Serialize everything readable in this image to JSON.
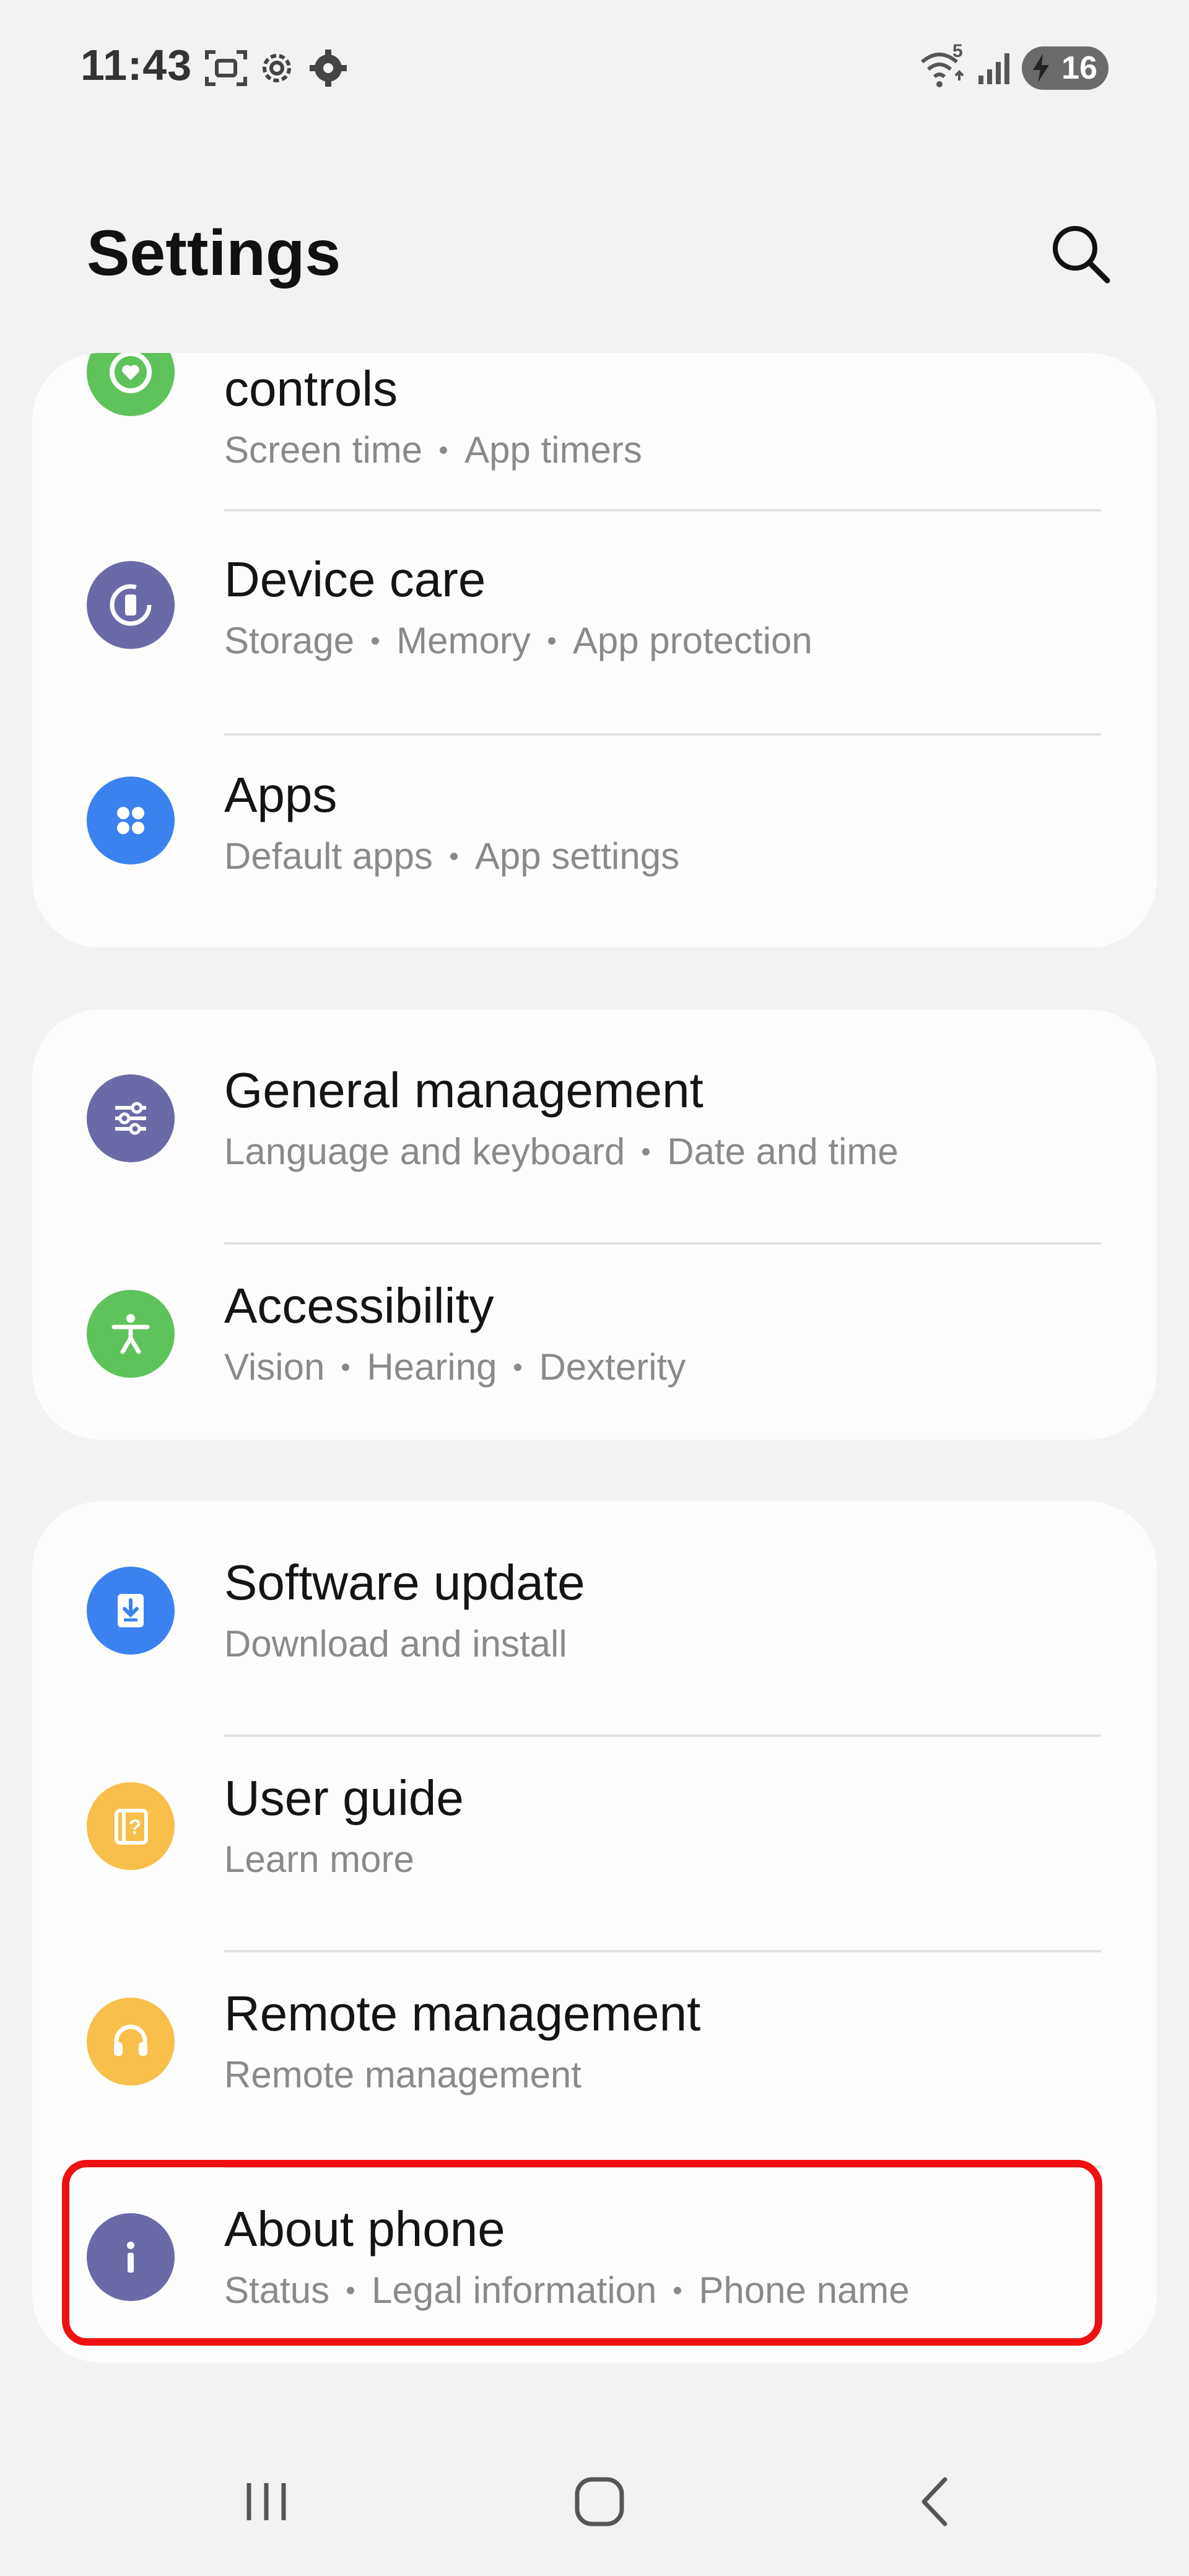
{
  "status_bar": {
    "time": "11:43",
    "wifi_badge": "5",
    "battery_level": "16",
    "icons": [
      "screenshot-icon",
      "settings-gear-outline-icon",
      "settings-gear-icon",
      "wifi-icon",
      "signal-icon",
      "battery-charging-icon"
    ]
  },
  "header": {
    "title": "Settings"
  },
  "sections": [
    {
      "items": [
        {
          "label": "controls",
          "subtitle": [
            "Screen time",
            "App timers"
          ],
          "icon": "digital-wellbeing-icon",
          "color": "#5ec35a"
        },
        {
          "label": "Device care",
          "subtitle": [
            "Storage",
            "Memory",
            "App protection"
          ],
          "icon": "device-care-icon",
          "color": "#6a6aa8"
        },
        {
          "label": "Apps",
          "subtitle": [
            "Default apps",
            "App settings"
          ],
          "icon": "apps-icon",
          "color": "#3b82f0"
        }
      ]
    },
    {
      "items": [
        {
          "label": "General management",
          "subtitle": [
            "Language and keyboard",
            "Date and time"
          ],
          "icon": "sliders-icon",
          "color": "#6a6aa8"
        },
        {
          "label": "Accessibility",
          "subtitle": [
            "Vision",
            "Hearing",
            "Dexterity"
          ],
          "icon": "accessibility-icon",
          "color": "#5ec35a"
        }
      ]
    },
    {
      "items": [
        {
          "label": "Software update",
          "subtitle": [
            "Download and install"
          ],
          "icon": "software-update-icon",
          "color": "#3b82f0"
        },
        {
          "label": "User guide",
          "subtitle": [
            "Learn more"
          ],
          "icon": "user-guide-icon",
          "color": "#f8bf4a"
        },
        {
          "label": "Remote management",
          "subtitle": [
            "Remote management"
          ],
          "icon": "headset-icon",
          "color": "#f8bf4a"
        },
        {
          "label": "About phone",
          "subtitle": [
            "Status",
            "Legal information",
            "Phone name"
          ],
          "icon": "info-icon",
          "color": "#6a6aa8"
        }
      ]
    }
  ],
  "nav_bar": {
    "buttons": [
      "recents-icon",
      "home-icon",
      "back-icon"
    ]
  }
}
